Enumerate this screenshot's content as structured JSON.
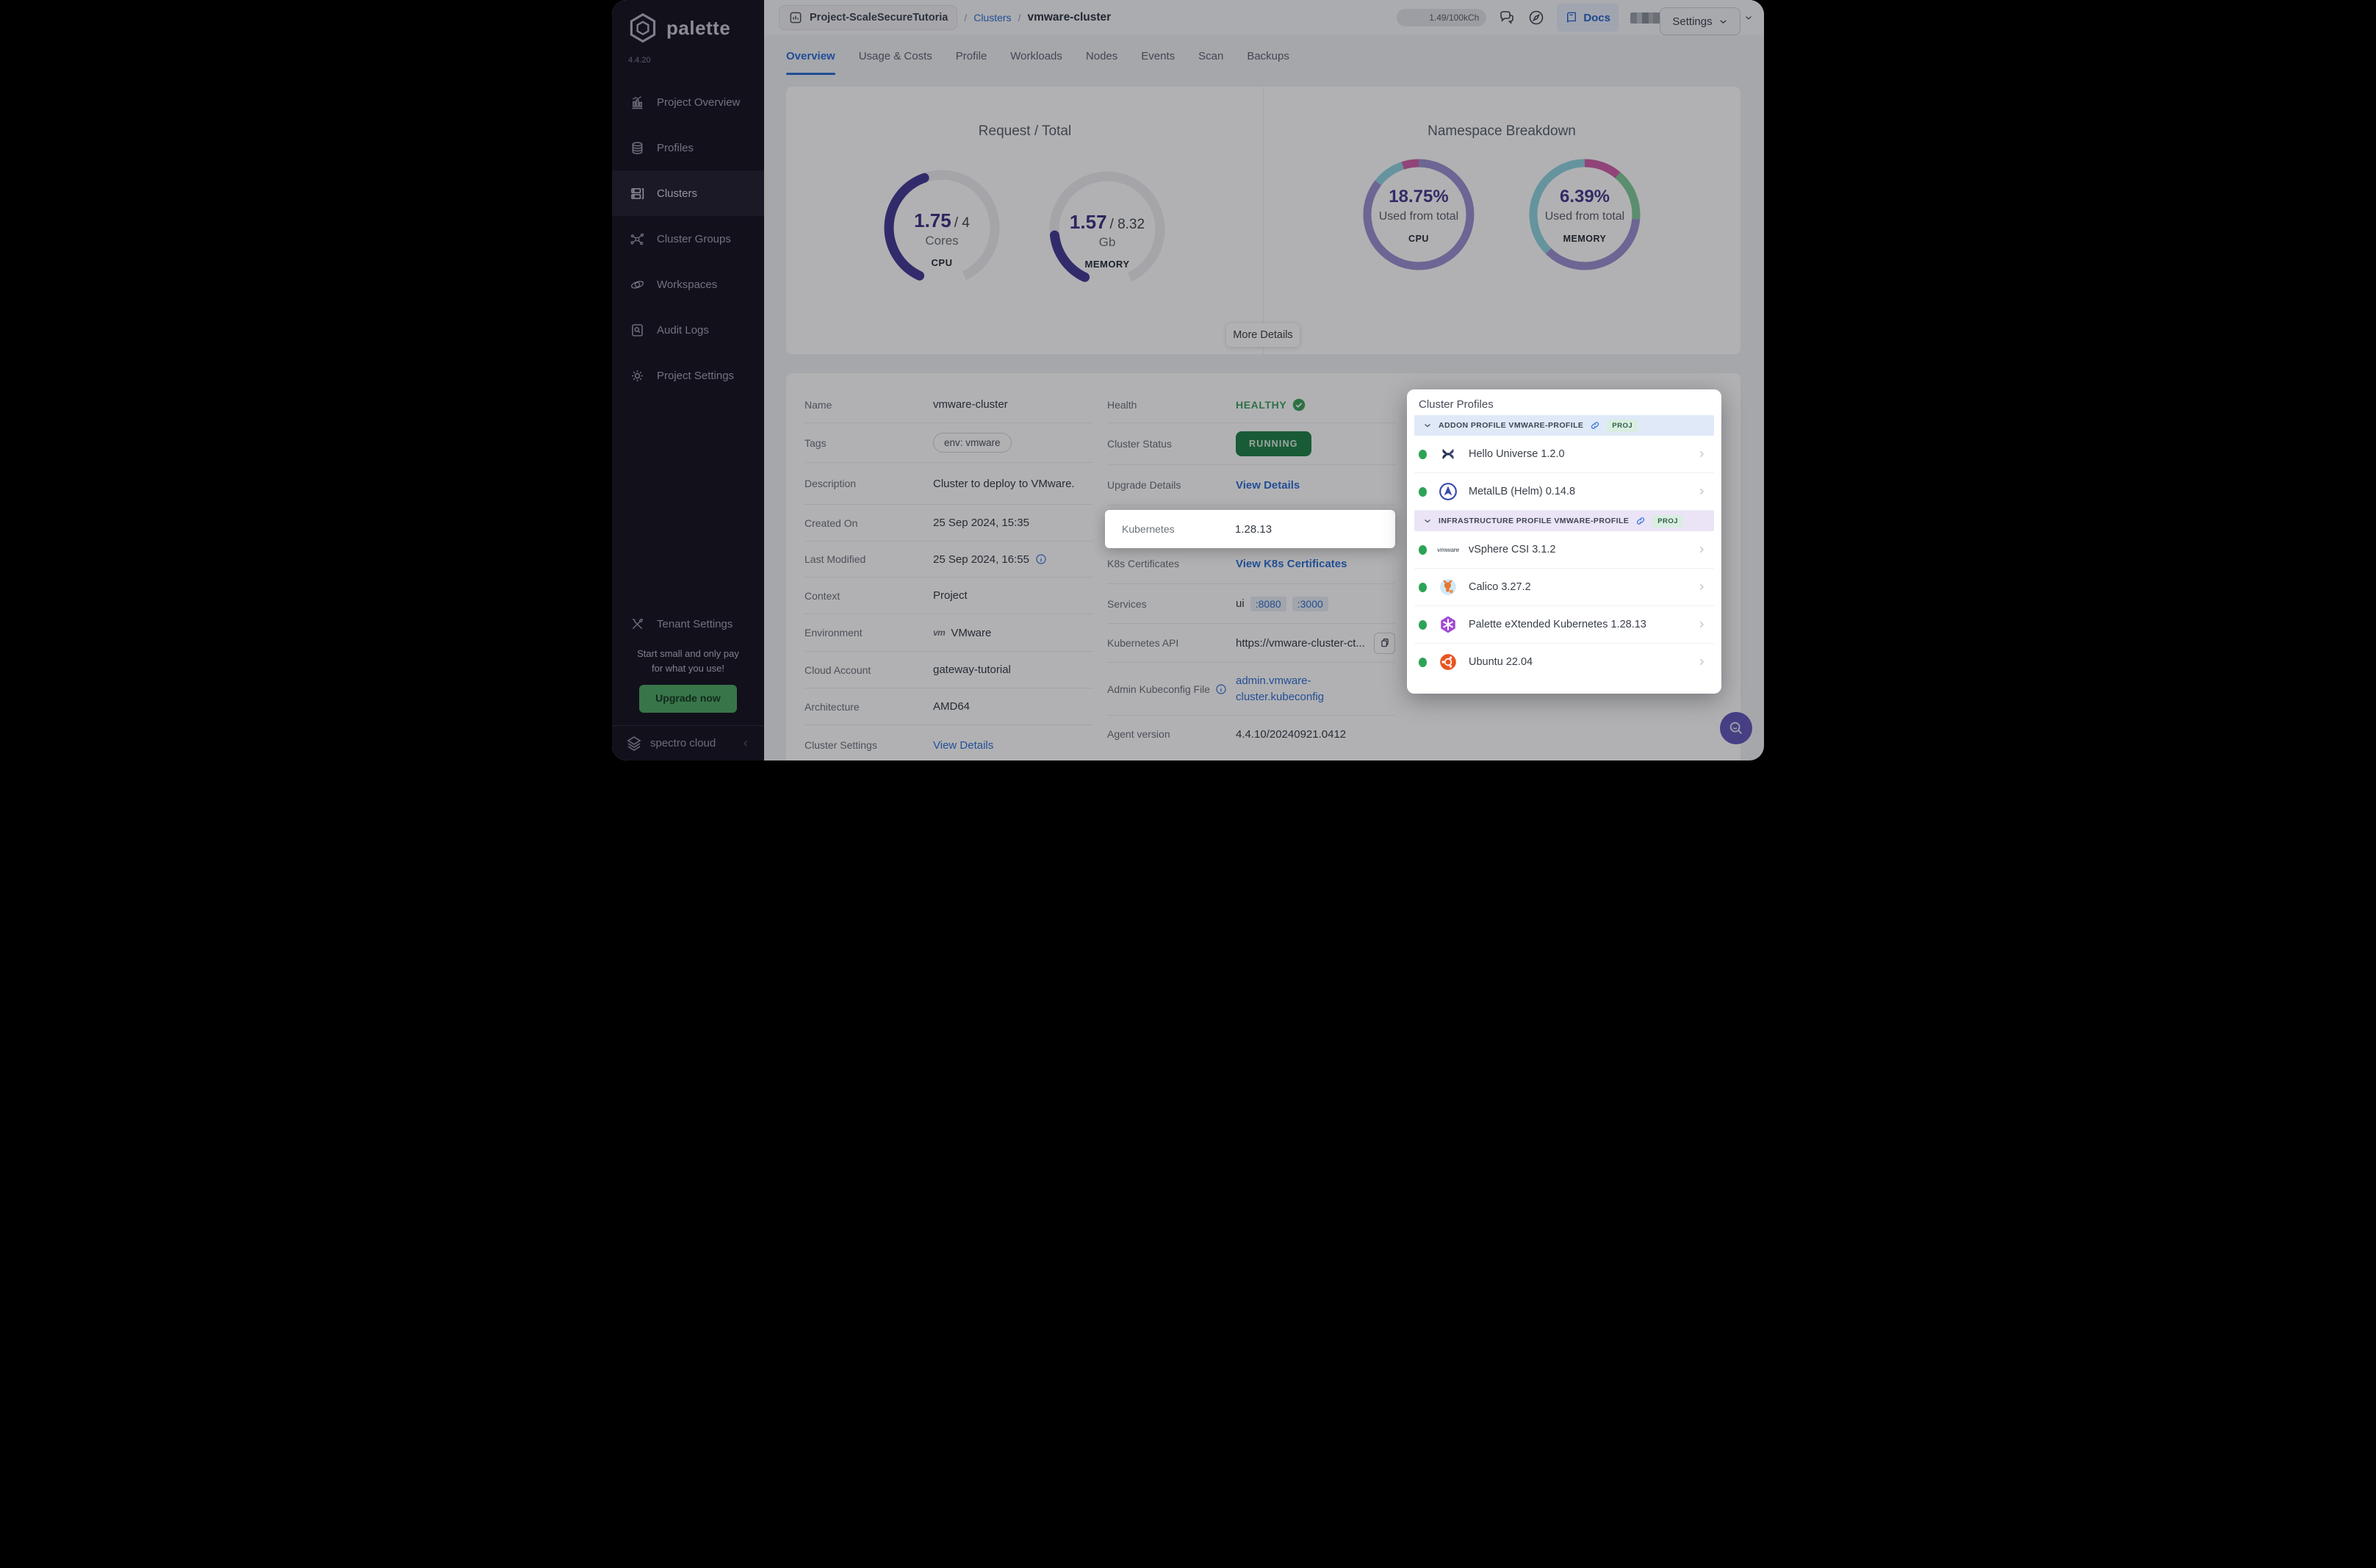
{
  "app": {
    "logo_text": "palette",
    "version": "4.4.20",
    "footer_brand": "spectro cloud"
  },
  "sidebar": {
    "items": [
      {
        "label": "Project Overview"
      },
      {
        "label": "Profiles"
      },
      {
        "label": "Clusters"
      },
      {
        "label": "Cluster Groups"
      },
      {
        "label": "Workspaces"
      },
      {
        "label": "Audit Logs"
      },
      {
        "label": "Project Settings"
      }
    ],
    "active_item": "Clusters",
    "tenant_label": "Tenant Settings",
    "promo_line1": "Start small and only pay",
    "promo_line2": "for what you use!",
    "upgrade_cta": "Upgrade now"
  },
  "header": {
    "project": "Project-ScaleSecureTutoria",
    "breadcrumb_section": "Clusters",
    "breadcrumb_sep": "/",
    "breadcrumb_current": "vmware-cluster",
    "usage_pill": "1.49/100kCh",
    "docs_label": "Docs"
  },
  "tabs": {
    "items": [
      "Overview",
      "Usage & Costs",
      "Profile",
      "Workloads",
      "Nodes",
      "Events",
      "Scan",
      "Backups"
    ],
    "active": "Overview",
    "settings_label": "Settings"
  },
  "overview": {
    "more_details": "More Details"
  },
  "chart_data": [
    {
      "type": "gauge",
      "title": "Request / Total",
      "gauges": [
        {
          "label": "CPU",
          "value": 1.75,
          "total": 4,
          "value_display": "1.75",
          "total_display": "/ 4",
          "unit": "Cores",
          "color": "#453a96",
          "track": "#ececf1",
          "start_deg": 205,
          "span_deg": 310
        },
        {
          "label": "MEMORY",
          "value": 1.57,
          "total": 8.32,
          "value_display": "1.57",
          "total_display": "/ 8.32",
          "unit": "Gb",
          "color": "#453a96",
          "track": "#ececf1",
          "start_deg": 205,
          "span_deg": 310
        }
      ]
    },
    {
      "type": "donut",
      "title": "Namespace Breakdown",
      "donuts": [
        {
          "label": "CPU",
          "percent": "18.75%",
          "subtitle": "Used from total",
          "segments": [
            {
              "name": "used-purple",
              "color": "#9b8fd0",
              "start": 0,
              "end": 308
            },
            {
              "name": "cyan",
              "color": "#8fd4e0",
              "start": 308,
              "end": 342
            },
            {
              "name": "pink",
              "color": "#d05fa8",
              "start": 342,
              "end": 360
            }
          ]
        },
        {
          "label": "MEMORY",
          "percent": "6.39%",
          "subtitle": "Used from total",
          "segments": [
            {
              "name": "pink",
              "color": "#d05fa8",
              "start": 0,
              "end": 40
            },
            {
              "name": "green",
              "color": "#7fcc9a",
              "start": 40,
              "end": 95
            },
            {
              "name": "purple",
              "color": "#9b8fd0",
              "start": 95,
              "end": 225
            },
            {
              "name": "teal",
              "color": "#8fd4e0",
              "start": 225,
              "end": 360
            }
          ]
        }
      ]
    }
  ],
  "details": {
    "left": [
      {
        "label": "Name",
        "value": "vmware-cluster"
      },
      {
        "label": "Tags",
        "value": "env: vmware"
      },
      {
        "label": "Description",
        "value": "Cluster to deploy to VMware."
      },
      {
        "label": "Created On",
        "value": "25 Sep 2024, 15:35"
      },
      {
        "label": "Last Modified",
        "value": "25 Sep 2024, 16:55"
      },
      {
        "label": "Context",
        "value": "Project"
      },
      {
        "label": "Environment",
        "value": "VMware",
        "logo": "vm"
      },
      {
        "label": "Cloud Account",
        "value": "gateway-tutorial"
      },
      {
        "label": "Architecture",
        "value": "AMD64"
      },
      {
        "label": "Cluster Settings",
        "value": "View Details"
      }
    ],
    "right": {
      "health_label": "Health",
      "health_value": "HEALTHY",
      "status_label": "Cluster Status",
      "status_value": "RUNNING",
      "upgrade_label": "Upgrade Details",
      "upgrade_value": "View Details",
      "kubernetes_label": "Kubernetes",
      "kubernetes_value": "1.28.13",
      "certs_label": "K8s Certificates",
      "certs_value": "View K8s Certificates",
      "services_label": "Services",
      "services_name": "ui",
      "services_ports": [
        ":8080",
        ":3000"
      ],
      "api_label": "Kubernetes API",
      "api_value": "https://vmware-cluster-ct...",
      "kubeconfig_label": "Admin Kubeconfig File",
      "kubeconfig_line1": "admin.vmware-",
      "kubeconfig_line2": "cluster.kubeconfig",
      "agent_label": "Agent version",
      "agent_value": "4.4.10/20240921.0412"
    }
  },
  "profiles_panel": {
    "title": "Cluster Profiles",
    "badge": "PROJ",
    "sections": [
      {
        "name": "ADDON PROFILE VMWARE-PROFILE",
        "items": [
          {
            "name": "Hello Universe 1.2.0",
            "icon": "hello-universe-icon"
          },
          {
            "name": "MetalLB (Helm) 0.14.8",
            "icon": "metallb-icon"
          }
        ]
      },
      {
        "name": "INFRASTRUCTURE PROFILE VMWARE-PROFILE",
        "items": [
          {
            "name": "vSphere CSI 3.1.2",
            "icon": "vmware-icon"
          },
          {
            "name": "Calico 3.27.2",
            "icon": "calico-icon"
          },
          {
            "name": "Palette eXtended Kubernetes 1.28.13",
            "icon": "pxk-icon"
          },
          {
            "name": "Ubuntu 22.04",
            "icon": "ubuntu-icon"
          }
        ]
      }
    ]
  },
  "colors": {
    "accent_blue": "#2f6fd3",
    "gauge_indigo": "#453a96",
    "status_green": "#1f8048",
    "healthy_green": "#3da15f",
    "sidebar_bg": "#15131f"
  }
}
